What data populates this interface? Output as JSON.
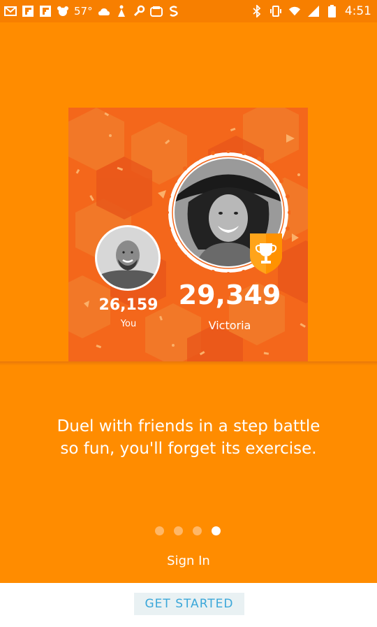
{
  "status_bar": {
    "temperature": "57°",
    "time": "4:51"
  },
  "hero": {
    "you": {
      "score": "26,159",
      "label": "You"
    },
    "rival": {
      "score": "29,349",
      "label": "Victoria"
    }
  },
  "onboarding": {
    "tagline_line1": "Duel with friends in a step battle",
    "tagline_line2": "so fun, you'll forget its exercise.",
    "page_count": 4,
    "active_page": 4
  },
  "actions": {
    "sign_in": "Sign In",
    "get_started": "GET STARTED"
  },
  "colors": {
    "background": "#FF8C00",
    "hero_bg": "#F4671B",
    "trophy": "#FFA41A",
    "button_text": "#3BA7D9"
  }
}
